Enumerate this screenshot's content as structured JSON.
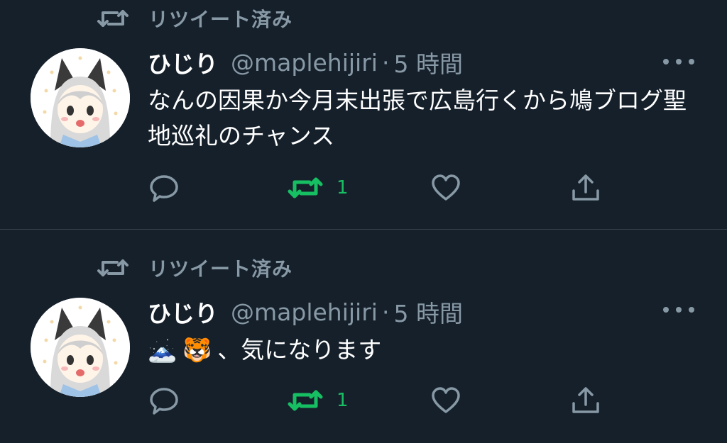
{
  "tweets": [
    {
      "retweet_label": "リツイート済み",
      "display_name": "ひじり",
      "handle": "@maplehijiri",
      "separator": "·",
      "timestamp": "5 時間",
      "text": "なんの因果か今月末出張で広島行くから鳩ブログ聖地巡礼のチャンス",
      "emojis": [],
      "retweet_count": "1"
    },
    {
      "retweet_label": "リツイート済み",
      "display_name": "ひじり",
      "handle": "@maplehijiri",
      "separator": "·",
      "timestamp": "5 時間",
      "text": "、気になります",
      "emojis": [
        "🗻",
        "🐯"
      ],
      "retweet_count": "1"
    }
  ],
  "colors": {
    "background": "#15202b",
    "secondary_text": "#8899a6",
    "retweet_active": "#17bf63",
    "divider": "#38444d"
  },
  "icons": [
    "retweet-icon",
    "avatar",
    "more-icon",
    "reply-icon",
    "retweet-icon",
    "like-icon",
    "share-icon"
  ]
}
